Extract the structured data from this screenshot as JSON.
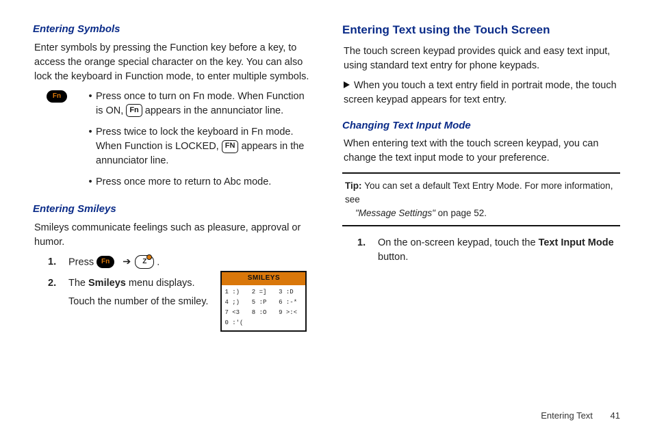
{
  "left": {
    "h_symbols": "Entering Symbols",
    "symbols_intro": "Enter symbols by pressing the Function key before a key, to access the orange special character on the key. You can also lock the keyboard in Function mode, to enter multiple symbols.",
    "fn_label": "Fn",
    "bullet1a": "Press once to turn on Fn mode. When Function is ON, ",
    "fn_icon_text": "Fn",
    "bullet1b": " appears in the annunciator line.",
    "bullet2a": "Press twice to lock the keyboard in Fn mode. When Function is LOCKED, ",
    "fn_icon_bold": "FN",
    "bullet2b": " appears in the annunciator line.",
    "bullet3": "Press once more to return to Abc mode.",
    "h_smileys": "Entering Smileys",
    "smileys_intro": "Smileys communicate feelings such as pleasure, approval or humor.",
    "step1_press": "Press ",
    "step1_period": " .",
    "z_label": "Z",
    "arrow": "➔",
    "step2a": "The ",
    "step2_bold": "Smileys",
    "step2b": " menu displays.",
    "step2c": "Touch the number of the smiley.",
    "smileys_header": "SMILEYS",
    "smileys_cells": [
      "1 :)",
      "2 =]",
      "3 :D",
      "4 ;)",
      "5 :P",
      "6 :-*",
      "7 <3",
      "8 :O",
      "9 >:<",
      "0 :'("
    ]
  },
  "right": {
    "h_touch": "Entering Text using the Touch Screen",
    "touch_intro": "The touch screen keypad provides quick and easy text input, using standard text entry for phone keypads.",
    "touch_bullet": "When you touch a text entry field in portrait mode, the touch screen keypad appears for text entry.",
    "h_change": "Changing Text Input Mode",
    "change_intro": "When entering text with the touch screen keypad, you can change the text input mode to your preference.",
    "tip_label": "Tip: ",
    "tip_body1": "You can set a default Text Entry Mode. For more information, see ",
    "tip_ref": "\"Message Settings\"",
    "tip_body2": " on page 52.",
    "step1a": "On the on-screen keypad, touch the ",
    "step1_bold": "Text Input Mode",
    "step1b": " button."
  },
  "footer": {
    "section": "Entering Text",
    "page": "41"
  }
}
